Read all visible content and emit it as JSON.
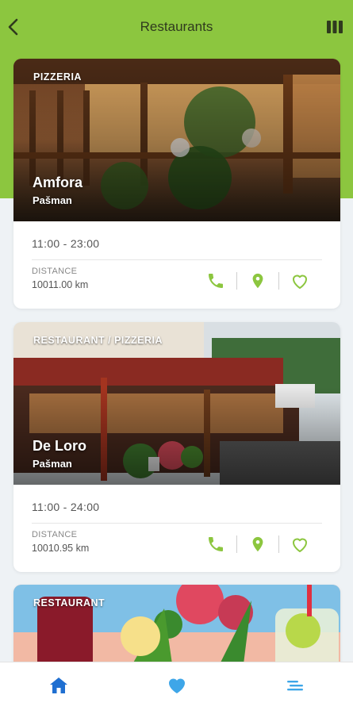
{
  "header": {
    "title": "Restaurants",
    "back_icon": "chevron-left-icon",
    "view_icon": "columns-icon"
  },
  "colors": {
    "accent": "#8cc63f",
    "brand_blue": "#1f6fd1",
    "nav_light_blue": "#3ea6e8"
  },
  "restaurants": [
    {
      "category": "PIZZERIA",
      "name": "Amfora",
      "place": "Pašman",
      "hours": "11:00 - 23:00",
      "distance_label": "DISTANCE",
      "distance": "10011.00 km"
    },
    {
      "category": "RESTAURANT / PIZZERIA",
      "name": "De Loro",
      "place": "Pašman",
      "hours": "11:00 - 24:00",
      "distance_label": "DISTANCE",
      "distance": "10010.95 km"
    },
    {
      "category": "RESTAURANT"
    }
  ],
  "bottom_nav": {
    "items": [
      "home-icon",
      "heart-icon",
      "menu-icon"
    ],
    "active": "home-icon"
  }
}
